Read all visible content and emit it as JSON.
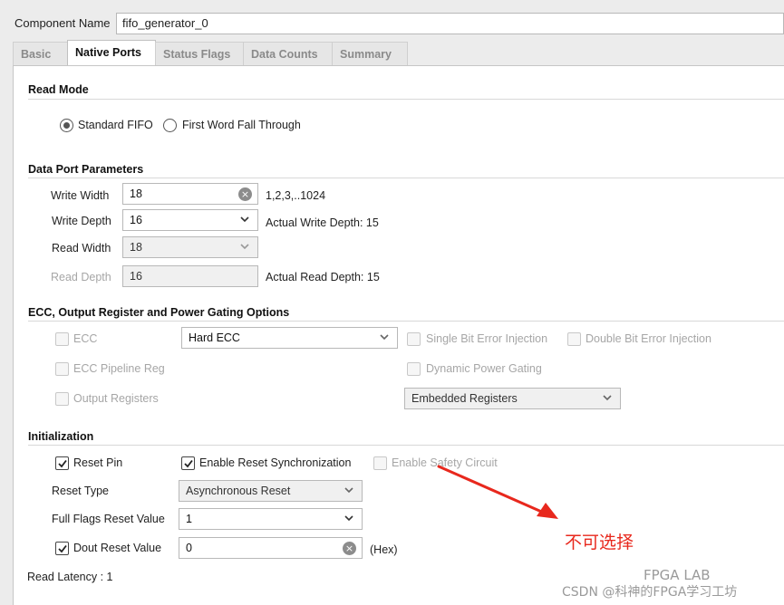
{
  "component": {
    "label": "Component Name",
    "value": "fifo_generator_0"
  },
  "tabs": [
    {
      "label": "Basic",
      "active": false
    },
    {
      "label": "Native Ports",
      "active": true
    },
    {
      "label": "Status Flags",
      "active": false
    },
    {
      "label": "Data Counts",
      "active": false
    },
    {
      "label": "Summary",
      "active": false
    }
  ],
  "read_mode": {
    "title": "Read Mode",
    "standard_fifo": "Standard FIFO",
    "fwft": "First Word Fall Through",
    "selected": "standard_fifo"
  },
  "data_port": {
    "title": "Data Port Parameters",
    "write_width_label": "Write Width",
    "write_width_value": "18",
    "write_width_hint": "1,2,3,..1024",
    "write_depth_label": "Write Depth",
    "write_depth_value": "16",
    "write_depth_hint": "Actual Write Depth: 15",
    "read_width_label": "Read Width",
    "read_width_value": "18",
    "read_depth_label": "Read Depth",
    "read_depth_value": "16",
    "read_depth_hint": "Actual Read Depth: 15"
  },
  "ecc": {
    "title": "ECC, Output Register and Power Gating Options",
    "ecc_label": "ECC",
    "ecc_type": "Hard ECC",
    "single_bit": "Single Bit Error Injection",
    "double_bit": "Double Bit Error Injection",
    "ecc_pipeline": "ECC Pipeline Reg",
    "dynamic_power": "Dynamic Power Gating",
    "output_registers": "Output Registers",
    "register_type": "Embedded Registers"
  },
  "init": {
    "title": "Initialization",
    "reset_pin": "Reset Pin",
    "enable_reset_sync": "Enable Reset Synchronization",
    "enable_safety": "Enable Safety Circuit",
    "reset_type_label": "Reset Type",
    "reset_type_value": "Asynchronous Reset",
    "full_flags_label": "Full Flags Reset Value",
    "full_flags_value": "1",
    "dout_reset_label": "Dout Reset Value",
    "dout_reset_value": "0",
    "dout_reset_unit": "(Hex)",
    "read_latency": "Read Latency : 1"
  },
  "annotation": {
    "text": "不可选择",
    "color": "#e8281d"
  },
  "watermark": {
    "csdn": "CSDN @科神的FPGA学习工坊",
    "lab": "FPGA LAB"
  }
}
